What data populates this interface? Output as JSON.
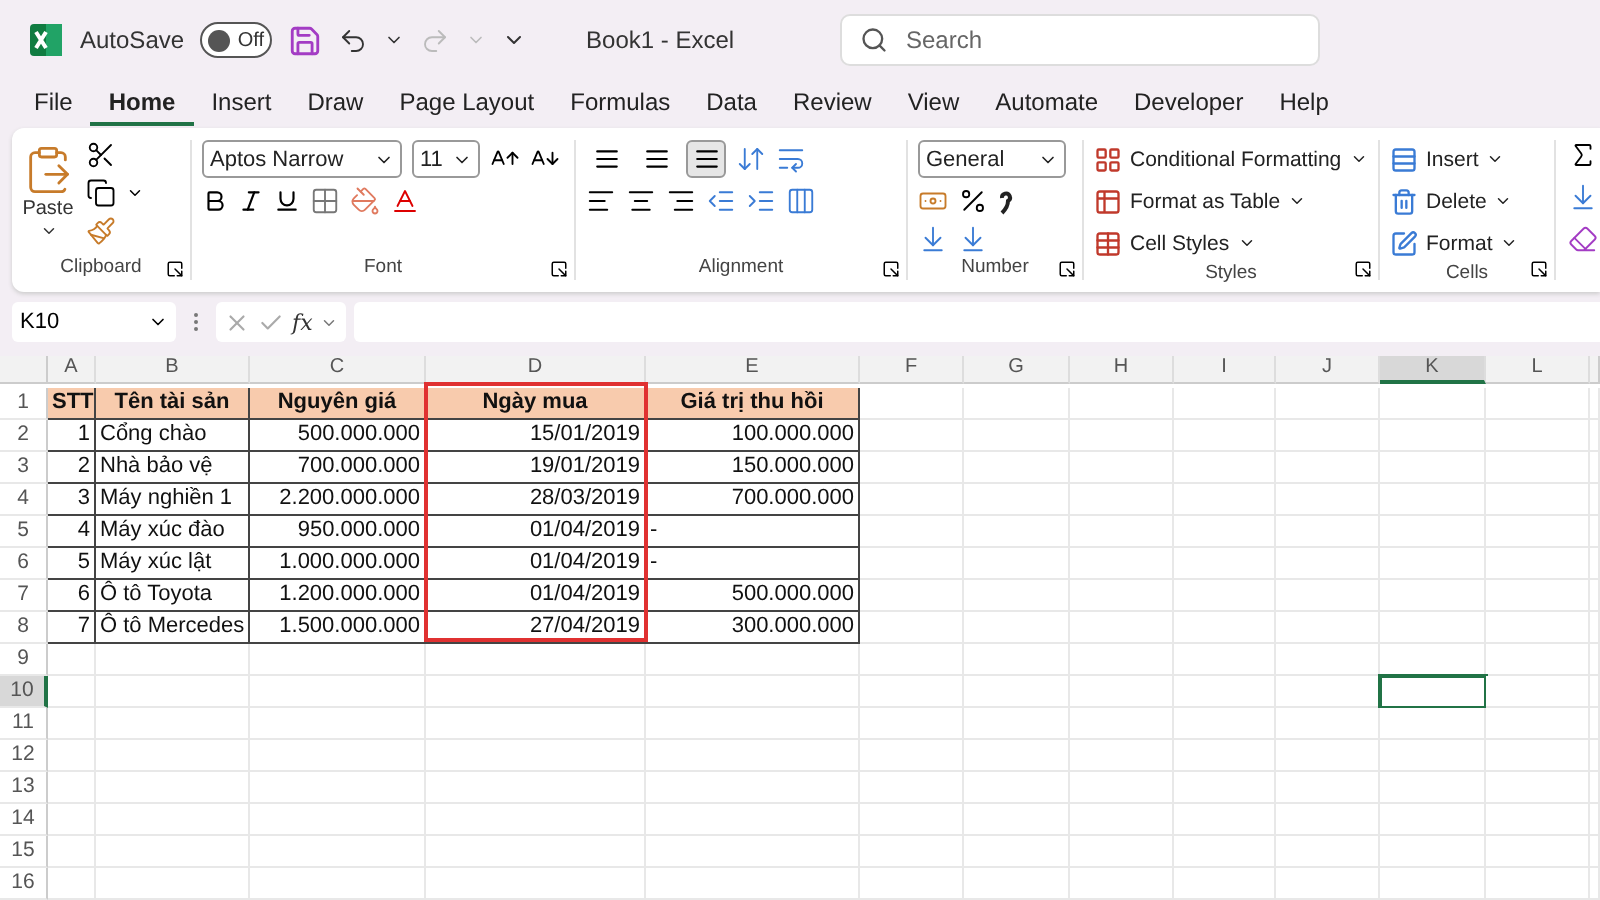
{
  "window": {
    "title": "Book1  -  Excel",
    "autosave_label": "AutoSave",
    "autosave_toggle": {
      "label": "Off",
      "on": false
    }
  },
  "search": {
    "placeholder": "Search"
  },
  "tabs": [
    {
      "label": "File",
      "selected": false
    },
    {
      "label": "Home",
      "selected": true
    },
    {
      "label": "Insert",
      "selected": false
    },
    {
      "label": "Draw",
      "selected": false
    },
    {
      "label": "Page Layout",
      "selected": false
    },
    {
      "label": "Formulas",
      "selected": false
    },
    {
      "label": "Data",
      "selected": false
    },
    {
      "label": "Review",
      "selected": false
    },
    {
      "label": "View",
      "selected": false
    },
    {
      "label": "Automate",
      "selected": false
    },
    {
      "label": "Developer",
      "selected": false
    },
    {
      "label": "Help",
      "selected": false
    }
  ],
  "ribbon": {
    "clipboard": {
      "title": "Clipboard",
      "paste_label": "Paste"
    },
    "font": {
      "title": "Font",
      "font_name": "Aptos Narrow",
      "font_size": "11"
    },
    "alignment": {
      "title": "Alignment",
      "vertical_buttons": [
        {
          "selected": false
        },
        {
          "selected": false
        },
        {
          "selected": true
        }
      ]
    },
    "number": {
      "title": "Number",
      "format": "General"
    },
    "styles": {
      "title": "Styles",
      "buttons": [
        "Conditional Formatting",
        "Format as Table",
        "Cell Styles"
      ]
    },
    "cells": {
      "title": "Cells",
      "buttons": [
        "Insert",
        "Delete",
        "Format"
      ]
    }
  },
  "formula_bar": {
    "name_box": "K10",
    "function_label": "fx"
  },
  "sheet": {
    "columns": [
      {
        "letter": "A",
        "kind": "number",
        "selected": false,
        "highlighted": false
      },
      {
        "letter": "B",
        "kind": "text",
        "selected": false,
        "highlighted": false
      },
      {
        "letter": "C",
        "kind": "number",
        "selected": false,
        "highlighted": false
      },
      {
        "letter": "D",
        "kind": "number",
        "selected": false,
        "highlighted": true
      },
      {
        "letter": "E",
        "kind": "number",
        "selected": false,
        "highlighted": false
      },
      {
        "letter": "F",
        "kind": "text",
        "selected": false,
        "highlighted": false
      },
      {
        "letter": "G",
        "kind": "text",
        "selected": false,
        "highlighted": false
      },
      {
        "letter": "H",
        "kind": "text",
        "selected": false,
        "highlighted": false
      },
      {
        "letter": "I",
        "kind": "text",
        "selected": false,
        "highlighted": false
      },
      {
        "letter": "J",
        "kind": "text",
        "selected": false,
        "highlighted": false
      },
      {
        "letter": "K",
        "kind": "text",
        "selected": true,
        "highlighted": false
      },
      {
        "letter": "L",
        "kind": "text",
        "selected": false,
        "highlighted": false
      }
    ],
    "rows": [
      {
        "number": "1",
        "kind": "header",
        "selected": false,
        "cells": [
          "STT",
          "Tên tài sản",
          "Nguyên giá",
          "Ngày mua",
          "Giá trị thu hồi"
        ]
      },
      {
        "number": "2",
        "kind": "data",
        "selected": false,
        "cells": [
          "1",
          "Cổng chào",
          "500.000.000",
          "15/01/2019",
          "100.000.000"
        ]
      },
      {
        "number": "3",
        "kind": "data",
        "selected": false,
        "cells": [
          "2",
          "Nhà bảo vệ",
          "700.000.000",
          "19/01/2019",
          "150.000.000"
        ]
      },
      {
        "number": "4",
        "kind": "data",
        "selected": false,
        "cells": [
          "3",
          "Máy nghiền 1",
          "2.200.000.000",
          "28/03/2019",
          "700.000.000"
        ]
      },
      {
        "number": "5",
        "kind": "data",
        "selected": false,
        "cells": [
          "4",
          "Máy xúc đào",
          "950.000.000",
          "01/04/2019",
          {
            "text": "-",
            "kind": "dash"
          }
        ]
      },
      {
        "number": "6",
        "kind": "data",
        "selected": false,
        "cells": [
          "5",
          "Máy xúc lật",
          "1.000.000.000",
          "01/04/2019",
          {
            "text": "-",
            "kind": "dash"
          }
        ]
      },
      {
        "number": "7",
        "kind": "data",
        "selected": false,
        "cells": [
          "6",
          "Ô tô Toyota",
          "1.200.000.000",
          "01/04/2019",
          "500.000.000"
        ]
      },
      {
        "number": "8",
        "kind": "data",
        "selected": false,
        "cells": [
          "7",
          "Ô tô Mercedes",
          "1.500.000.000",
          "27/04/2019",
          "300.000.000"
        ]
      },
      {
        "number": "9",
        "kind": "empty",
        "selected": false,
        "cells": []
      },
      {
        "number": "10",
        "kind": "empty",
        "selected": true,
        "cells": []
      },
      {
        "number": "11",
        "kind": "empty",
        "selected": false,
        "cells": []
      },
      {
        "number": "12",
        "kind": "empty",
        "selected": false,
        "cells": []
      },
      {
        "number": "13",
        "kind": "empty",
        "selected": false,
        "cells": []
      },
      {
        "number": "14",
        "kind": "empty",
        "selected": false,
        "cells": []
      },
      {
        "number": "15",
        "kind": "empty",
        "selected": false,
        "cells": []
      },
      {
        "number": "16",
        "kind": "empty",
        "selected": false,
        "cells": []
      }
    ]
  }
}
